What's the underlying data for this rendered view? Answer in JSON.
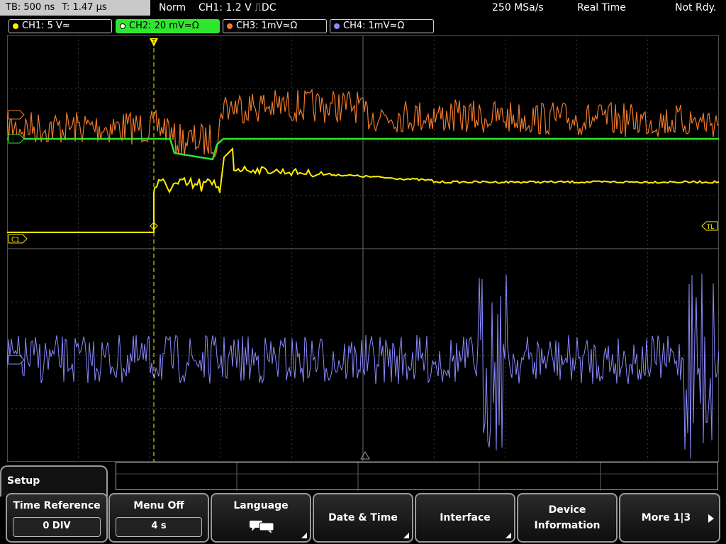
{
  "status_bar": {
    "timebase": "TB: 500 ns",
    "trigger_pos": "T: 1.47 µs",
    "mode": "Norm",
    "trigger_info": "CH1: 1.2 V ⎍DC",
    "sample_rate": "250 MSa/s",
    "acq_mode": "Real Time",
    "state": "Not Rdy."
  },
  "channels": [
    {
      "label": "CH1: 5 V≃",
      "color": "#ffee00",
      "active": false
    },
    {
      "label": "CH2: 20 mV≃Ω",
      "color": "#2ee62e",
      "active": true
    },
    {
      "label": "CH3: 1mV≃Ω",
      "color": "#f07a2a",
      "active": false
    },
    {
      "label": "CH4: 1mV≃Ω",
      "color": "#8a8aff",
      "active": false
    }
  ],
  "markers": {
    "trigger_level": "TL",
    "ch1_ref": "C1",
    "trigger_point": "T"
  },
  "panel": {
    "title": "Setup",
    "time_reference": {
      "label": "Time Reference",
      "value": "0 DIV"
    },
    "menu_off": {
      "label": "Menu Off",
      "value": "4 s"
    },
    "language": {
      "label": "Language",
      "icon": "speech-bubble-icon"
    },
    "date_time": "Date & Time",
    "interface": "Interface",
    "device_info_line1": "Device",
    "device_info_line2": "Information",
    "more": "More 1|3"
  }
}
